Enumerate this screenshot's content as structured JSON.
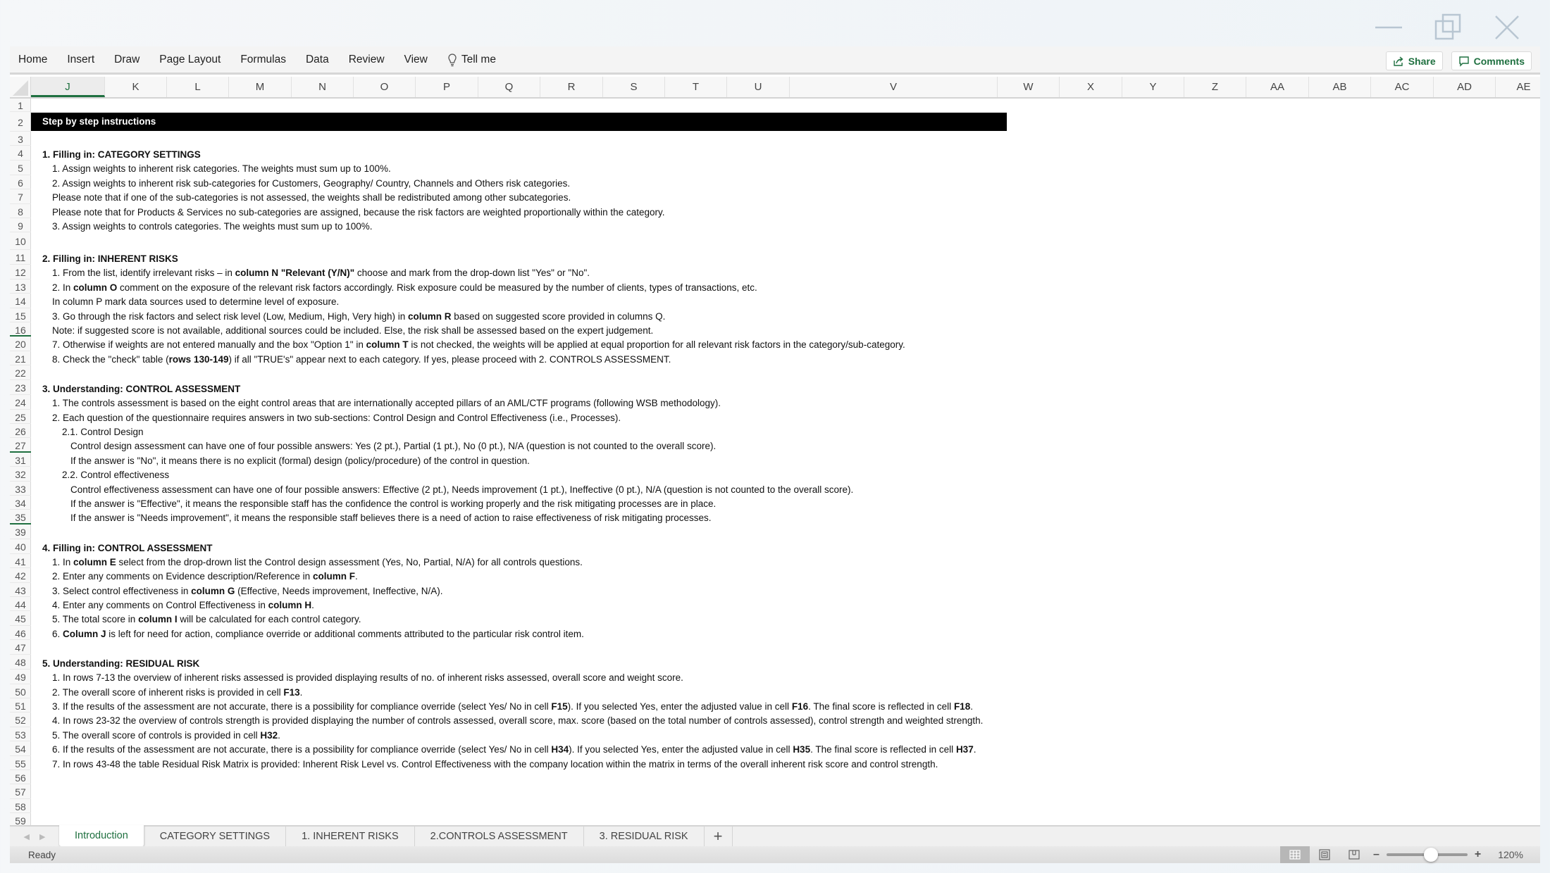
{
  "window": {
    "controls": [
      "minimize",
      "restore",
      "close"
    ]
  },
  "ribbon": {
    "tabs": [
      "Home",
      "Insert",
      "Draw",
      "Page Layout",
      "Formulas",
      "Data",
      "Review",
      "View"
    ],
    "tell_me": "Tell me",
    "share": "Share",
    "comments": "Comments"
  },
  "columns": [
    "J",
    "K",
    "L",
    "M",
    "N",
    "O",
    "P",
    "Q",
    "R",
    "S",
    "T",
    "U",
    "V",
    "W",
    "X",
    "Y",
    "Z",
    "AA",
    "AB",
    "AC",
    "AD",
    "AE"
  ],
  "active_column": "J",
  "rows": [
    {
      "n": "1",
      "type": "blank"
    },
    {
      "n": "2",
      "type": "banner",
      "html": "Step by step instructions"
    },
    {
      "n": "3",
      "type": "blank"
    },
    {
      "n": "4",
      "type": "heading",
      "html": "<b>1. Filling in: CATEGORY SETTINGS</b>"
    },
    {
      "n": "5",
      "type": "item",
      "html": "1. Assign weights to inherent risk categories. The weights must sum up to 100%."
    },
    {
      "n": "6",
      "type": "item",
      "html": "2. Assign weights to inherent risk sub-categories for Customers, Geography/ Country, Channels and Others risk categories."
    },
    {
      "n": "7",
      "type": "item",
      "html": "Please note that if one of the sub-categories is not assessed, the weights shall be redistributed among other subcategories."
    },
    {
      "n": "8",
      "type": "item",
      "html": "Please note that for Products &amp; Services no sub-categories are assigned, because the risk factors are weighted proportionally within the category."
    },
    {
      "n": "9",
      "type": "item",
      "html": "3. Assign weights to controls categories. The weights must sum up to 100%."
    },
    {
      "n": "10",
      "type": "blank"
    },
    {
      "n": "11",
      "type": "heading",
      "html": "<b>2. Filling in: INHERENT RISKS</b>"
    },
    {
      "n": "12",
      "type": "item",
      "html": "1. From the list, identify irrelevant risks – in <b>column N \"Relevant (Y/N)\"</b> choose and mark from the drop-down list \"Yes\" or \"No\"."
    },
    {
      "n": "13",
      "type": "item",
      "html": "2. In <b>column O</b> comment on the exposure of the relevant risk factors accordingly. Risk exposure could be measured by the number of clients, types of transactions, etc."
    },
    {
      "n": "14",
      "type": "item",
      "html": "In column P mark data sources used to determine level of exposure."
    },
    {
      "n": "15",
      "type": "item",
      "html": "3. Go through the risk factors and select risk level (Low, Medium, High, Very high) in <b>column R</b> based on suggested score provided in columns Q."
    },
    {
      "n": "16",
      "type": "item",
      "hidden_after": true,
      "html": "Note: if suggested score is not available, additional sources could be included. Else, the risk shall be assessed based on the expert judgement."
    },
    {
      "n": "20",
      "type": "item",
      "html": "7. Otherwise if weights are not entered manually and the box \"Option 1\" in <b>column T</b> is not checked, the weights will be applied at equal proportion for all relevant risk factors in the category/sub-category."
    },
    {
      "n": "21",
      "type": "item",
      "html": "8. Check the \"check\" table (<b>rows 130-149</b>) if all \"TRUE's\" appear next to each category. If yes, please proceed with 2. CONTROLS ASSESSMENT."
    },
    {
      "n": "22",
      "type": "blank"
    },
    {
      "n": "23",
      "type": "heading",
      "html": "<b>3. Understanding: CONTROL ASSESSMENT</b>"
    },
    {
      "n": "24",
      "type": "item",
      "html": "1. The controls assessment is based on the eight control areas that are internationally accepted pillars of an AML/CTF programs (following WSB methodology)."
    },
    {
      "n": "25",
      "type": "item",
      "html": "2. Each question of the questionnaire requires answers in two sub-sections: Control Design and Control Effectiveness (i.e., Processes)."
    },
    {
      "n": "26",
      "type": "sub",
      "html": "2.1. Control Design"
    },
    {
      "n": "27",
      "type": "sub2",
      "hidden_after": true,
      "html": "Control design assessment can have one of four possible answers: Yes (2 pt.), Partial (1 pt.), No (0 pt.), N/A (question is not counted to the overall score)."
    },
    {
      "n": "31",
      "type": "sub2",
      "html": "If the answer is \"No\", it means there is no explicit (formal) design (policy/procedure) of the control in question."
    },
    {
      "n": "32",
      "type": "sub",
      "html": "2.2. Control effectiveness"
    },
    {
      "n": "33",
      "type": "sub2",
      "html": "Control effectiveness assessment can have one of four possible answers: Effective (2 pt.), Needs improvement (1 pt.), Ineffective (0 pt.), N/A (question is not counted to the overall score)."
    },
    {
      "n": "34",
      "type": "sub2",
      "html": "If the answer is \"Effective\", it means the responsible staff has the confidence the control is working properly and the risk mitigating processes are in place."
    },
    {
      "n": "35",
      "type": "sub2",
      "hidden_after": true,
      "html": "If the answer is \"Needs improvement\", it means the responsible staff believes there is a need of action to raise effectiveness of risk mitigating processes."
    },
    {
      "n": "39",
      "type": "blank"
    },
    {
      "n": "40",
      "type": "heading",
      "html": "<b>4. Filling in: CONTROL ASSESSMENT</b>"
    },
    {
      "n": "41",
      "type": "item",
      "html": "1. In <b>column E</b> select from the drop-drown list the Control design assessment (Yes, No, Partial, N/A) for all controls questions."
    },
    {
      "n": "42",
      "type": "item",
      "html": "2. Enter any comments on Evidence description/Reference in <b>column F</b>."
    },
    {
      "n": "43",
      "type": "item",
      "html": "3. Select control effectiveness in <b>column G</b> (Effective, Needs improvement, Ineffective, N/A)."
    },
    {
      "n": "44",
      "type": "item",
      "html": "4. Enter any comments on Control Effectiveness in <b>column H</b>."
    },
    {
      "n": "45",
      "type": "item",
      "html": "5. The total score in <b>column I</b> will be calculated for each control category."
    },
    {
      "n": "46",
      "type": "item",
      "html": "6. <b>Column J</b> is left for need for action, compliance override or additional comments attributed to the particular risk control item."
    },
    {
      "n": "47",
      "type": "blank"
    },
    {
      "n": "48",
      "type": "heading",
      "html": "<b>5. Understanding: RESIDUAL RISK</b>"
    },
    {
      "n": "49",
      "type": "item",
      "html": "1. In rows 7-13 the overview of inherent risks assessed is provided displaying results of no. of inherent risks assessed, overall score and weight score."
    },
    {
      "n": "50",
      "type": "item",
      "html": "2. The overall score of inherent risks is provided in cell <b>F13</b>."
    },
    {
      "n": "51",
      "type": "item",
      "html": "3. If the results of the assessment are not accurate, there is a possibility for compliance override (select Yes/ No in cell <b>F15</b>). If you selected Yes, enter the adjusted value in cell <b>F16</b>. The final score is reflected in cell <b>F18</b>."
    },
    {
      "n": "52",
      "type": "item",
      "html": "4. In rows 23-32 the overview of controls strength is provided displaying the number of controls assessed, overall score, max. score (based on the total number of controls assessed), control strength and weighted strength."
    },
    {
      "n": "53",
      "type": "item",
      "html": "5. The overall score of controls is provided in cell <b>H32</b>."
    },
    {
      "n": "54",
      "type": "item",
      "html": "6. If the results of the assessment are not accurate, there is a possibility for compliance override (select Yes/ No in cell <b>H34</b>). If you selected Yes, enter the adjusted value in cell <b>H35</b>. The final score is reflected in cell <b>H37</b>."
    },
    {
      "n": "55",
      "type": "item",
      "html": "7. In rows 43-48 the table Residual Risk Matrix is provided: Inherent Risk Level vs. Control Effectiveness with the company location within the matrix in terms of the overall inherent risk score and control strength."
    },
    {
      "n": "56",
      "type": "blank"
    },
    {
      "n": "57",
      "type": "blank"
    },
    {
      "n": "58",
      "type": "blank"
    },
    {
      "n": "59",
      "type": "blank"
    }
  ],
  "sheet_tabs": [
    "Introduction",
    "CATEGORY SETTINGS",
    "1. INHERENT RISKS",
    "2.CONTROLS ASSESSMENT",
    "3. RESIDUAL RISK"
  ],
  "active_sheet": "Introduction",
  "add_sheet": "+",
  "status": {
    "text": "Ready",
    "views": [
      "normal",
      "page-layout",
      "page-break-preview"
    ],
    "active_view": "normal",
    "zoom_level": "120%",
    "zoom_fraction": 0.55
  },
  "colors": {
    "accent": "#1f7040",
    "banner_bg": "#000000",
    "banner_text": "#ffffff"
  }
}
